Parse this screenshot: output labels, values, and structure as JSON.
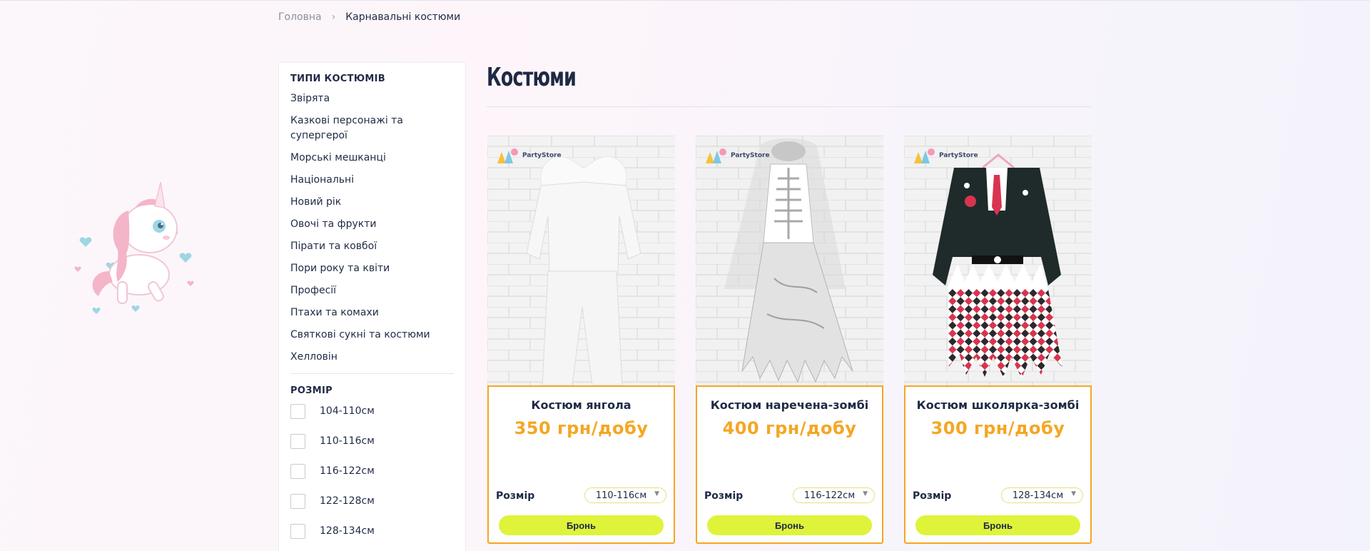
{
  "breadcrumb": {
    "home": "Головна",
    "separator": "›",
    "current": "Карнавальні костюми"
  },
  "sidebar": {
    "types_title": "ТИПИ КОСТЮМІВ",
    "categories": [
      "Звірята",
      "Казкові персонажі та супергерої",
      "Морські мешканці",
      "Національні",
      "Новий рік",
      "Овочі та фрукти",
      "Пірати та ковбої",
      "Пори року та квіти",
      "Професії",
      "Птахи та комахи",
      "Святкові сукні та костюми",
      "Хелловін"
    ],
    "size_title": "РОЗМІР",
    "sizes": [
      "104-110см",
      "110-116см",
      "116-122см",
      "122-128см",
      "128-134см"
    ]
  },
  "main": {
    "title": "Костюми"
  },
  "products": [
    {
      "name": "Костюм янгола",
      "price": "350 грн/добу",
      "size_label": "Розмір",
      "selected_size": "110-116см",
      "button": "Бронь",
      "logo": "PartyStore"
    },
    {
      "name": "Костюм наречена-зомбі",
      "price": "400 грн/добу",
      "size_label": "Розмір",
      "selected_size": "116-122см",
      "button": "Бронь",
      "logo": "PartyStore"
    },
    {
      "name": "Костюм школярка-зомбі",
      "price": "300 грн/добу",
      "size_label": "Розмір",
      "selected_size": "128-134см",
      "button": "Бронь",
      "logo": "PartyStore"
    }
  ],
  "colors": {
    "accent_orange": "#f5a623",
    "button_lime": "#dff33a",
    "text_dark": "#1f2a44"
  },
  "icons": {
    "breadcrumb_separator": "chevron-right-icon",
    "select_arrow": "chevron-down-icon",
    "decoration": "unicorn-illustration"
  }
}
